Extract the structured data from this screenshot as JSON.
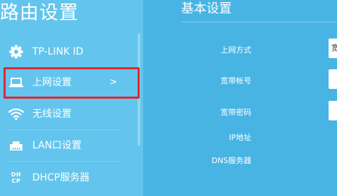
{
  "sidebar": {
    "title": "路由设置",
    "items": [
      {
        "label": "TP-LINK ID",
        "icon": "gear-icon"
      },
      {
        "label": "上网设置",
        "icon": "laptop-icon",
        "arrow": ">"
      },
      {
        "label": "无线设置",
        "icon": "wifi-icon"
      },
      {
        "label": "LAN口设置",
        "icon": "lan-port-icon"
      },
      {
        "label": "DHCP服务器",
        "icon": "dhcp-icon",
        "icon_text": "DHCP"
      }
    ]
  },
  "main": {
    "title": "基本设置",
    "form": {
      "connection_type_label": "上网方式",
      "connection_type_value": "宽",
      "account_label": "宽带帐号",
      "password_label": "宽带密码",
      "ip_label": "IP地址",
      "dns_label": "DNS服务器"
    }
  },
  "colors": {
    "sidebar_bg": "#63c5ed",
    "main_bg": "#47b4e4",
    "highlight_border": "#e0262f",
    "text": "#ffffff"
  }
}
